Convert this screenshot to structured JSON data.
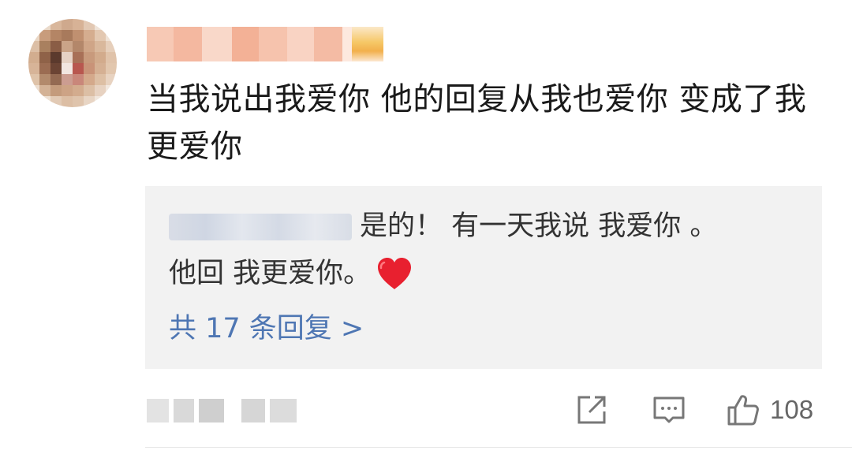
{
  "comment": {
    "main_text": "当我说出我爱你 他的回复从我也爱你 变成了我更爱你",
    "reply": {
      "text_line1": "是的！ 有一天我说 我爱你 。",
      "text_line2": "他回 我更爱你。",
      "emoji": "heart-emoji"
    },
    "more_replies_label": "共 17 条回复 >",
    "like_count": "108"
  },
  "colors": {
    "link": "#4e76b3",
    "reply_bg": "#f2f2f2",
    "text": "#1a1a1a",
    "heart": "#e8202f"
  },
  "icons": [
    "share-icon",
    "comment-icon",
    "thumbs-up-icon",
    "heart-emoji"
  ]
}
